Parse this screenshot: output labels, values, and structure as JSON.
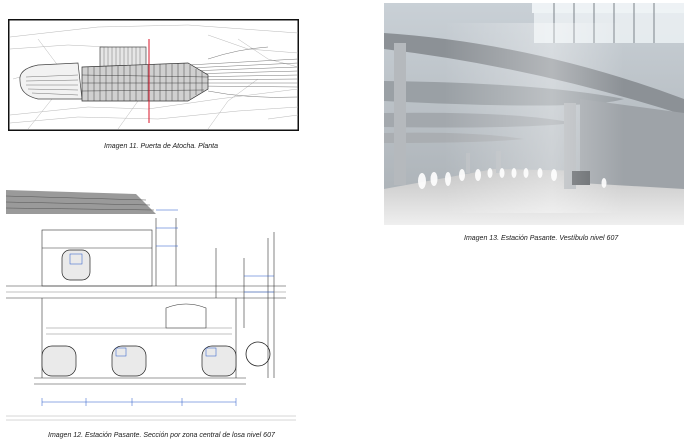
{
  "figures": [
    {
      "id": "img11",
      "caption": "Imagen 11. Puerta de Atocha. Planta"
    },
    {
      "id": "img12",
      "caption": "Imagen 12. Estación Pasante. Sección por zona central de losa nivel 607"
    },
    {
      "id": "img13",
      "caption": "Imagen 13. Estación Pasante. Vestíbulo nivel 607"
    }
  ]
}
